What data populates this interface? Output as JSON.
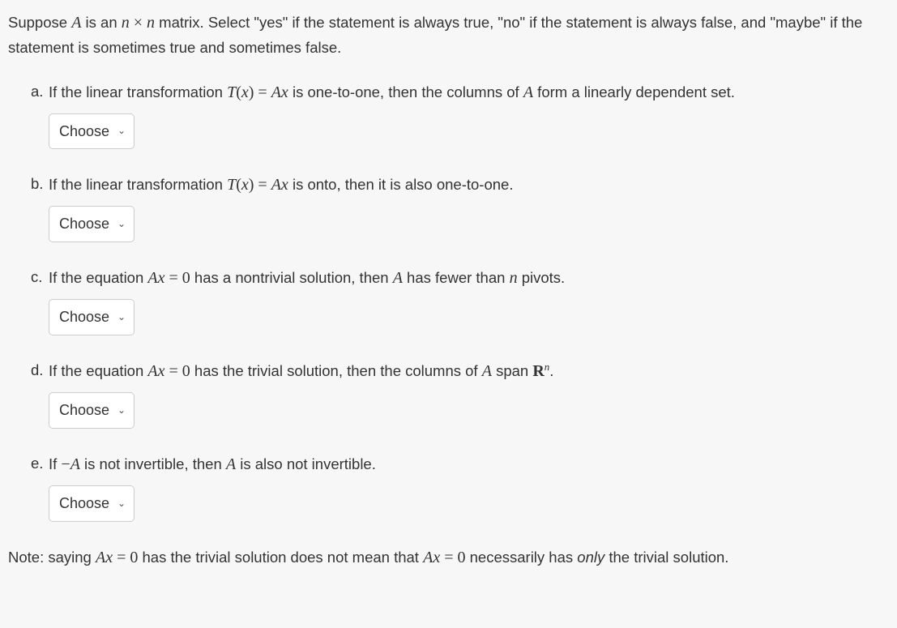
{
  "intro": {
    "pre": "Suppose ",
    "A": "A",
    "mid1": " is an ",
    "n1": "n",
    "times": " × ",
    "n2": "n",
    "mid2": " matrix. Select \"yes\" if the statement is always true, \"no\" if the statement is always false, and \"maybe\" if the statement is sometimes true and sometimes false."
  },
  "select_label": "Choose",
  "items": {
    "a": {
      "letter": "a. ",
      "p1": "If the linear transformation ",
      "T": "T",
      "lp": "(",
      "x": "x",
      "rp": ") = ",
      "A": "A",
      "x2": "x",
      "p2": " is one-to-one, then the columns of ",
      "A2": "A",
      "p3": " form a linearly dependent set."
    },
    "b": {
      "letter": "b. ",
      "p1": "If the linear transformation ",
      "T": "T",
      "lp": "(",
      "x": "x",
      "rp": ") = ",
      "A": "A",
      "x2": "x",
      "p2": " is onto, then it is also one-to-one."
    },
    "c": {
      "letter": "c. ",
      "p1": "If the equation ",
      "A": "A",
      "x": "x",
      "eq": " = 0",
      "p2": " has a nontrivial solution, then ",
      "A2": "A",
      "p3": " has fewer than ",
      "n": "n",
      "p4": " pivots."
    },
    "d": {
      "letter": "d. ",
      "p1": "If the equation ",
      "A": "A",
      "x": "x",
      "eq": " = 0",
      "p2": " has the trivial solution, then the columns of ",
      "A2": "A",
      "p3": " span ",
      "R": "R",
      "sup": "n",
      "p4": "."
    },
    "e": {
      "letter": "e. ",
      "p1": "If ",
      "neg": "−",
      "A": "A",
      "p2": " is not invertible, then ",
      "A2": "A",
      "p3": " is also not invertible."
    }
  },
  "note": {
    "p1": "Note: saying ",
    "A": "A",
    "x": "x",
    "eq": " = 0",
    "p2": " has the trivial solution does not mean that ",
    "A2": "A",
    "x2": "x",
    "eq2": " = 0",
    "p3": " necessarily has ",
    "only": "only",
    "p4": " the trivial solution."
  }
}
